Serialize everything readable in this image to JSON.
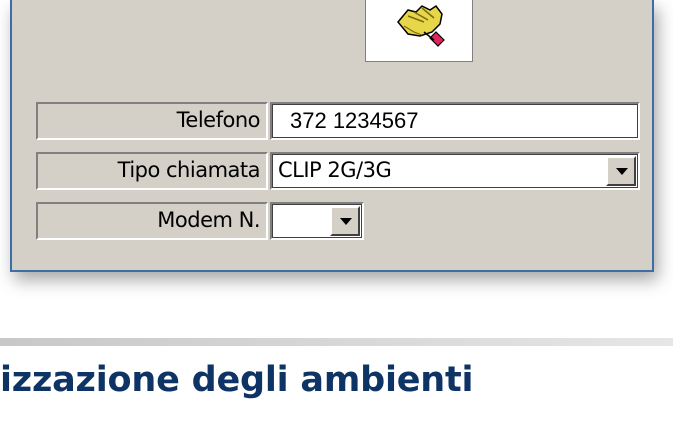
{
  "form": {
    "telefono": {
      "label": "Telefono",
      "value": "372 1234567"
    },
    "tipo_chiamata": {
      "label": "Tipo chiamata",
      "value": "CLIP 2G/3G"
    },
    "modem": {
      "label": "Modem N.",
      "value": ""
    }
  },
  "icons": {
    "hand_button": "hand-pointer-icon"
  },
  "section": {
    "heading": "izzazione degli ambienti"
  },
  "colors": {
    "dialog_bg": "#d4d0c8",
    "dialog_border": "#3a6ea5",
    "heading": "#0d3464"
  }
}
